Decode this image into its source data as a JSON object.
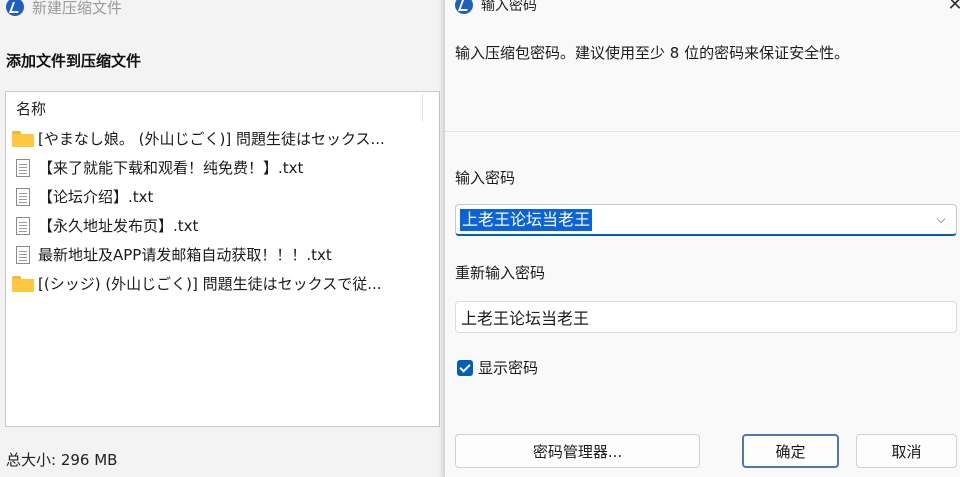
{
  "left_window": {
    "title": "新建压缩文件",
    "heading": "添加文件到压缩文件",
    "list_header": "名称",
    "files": [
      {
        "type": "folder",
        "name": "[やまなし娘。 (外山じごく)] 問題生徒はセックス..."
      },
      {
        "type": "file",
        "name": "【来了就能下载和观看！纯免费！】.txt"
      },
      {
        "type": "file",
        "name": "【论坛介绍】.txt"
      },
      {
        "type": "file",
        "name": "【永久地址发布页】.txt"
      },
      {
        "type": "file",
        "name": "最新地址及APP请发邮箱自动获取！！！.txt"
      },
      {
        "type": "folder",
        "name": "[(シッジ) (外山じごく)] 問題生徒はセックスで従..."
      }
    ],
    "total_size": "总大小: 296 MB"
  },
  "dialog": {
    "title": "输入密码",
    "description": "输入压缩包密码。建议使用至少 8 位的密码来保证安全性。",
    "password_label": "输入密码",
    "password_value": "上老王论坛当老王",
    "confirm_label": "重新输入密码",
    "confirm_value": "上老王论坛当老王",
    "show_password_label": "显示密码",
    "show_password_checked": true,
    "manager_button": "密码管理器...",
    "ok_button": "确定",
    "cancel_button": "取消",
    "close_glyph": "✕",
    "chevron_glyph": "⌵"
  },
  "colors": {
    "accent": "#005fb8",
    "selection": "#0a64d8",
    "folder": "#ffc83d"
  }
}
